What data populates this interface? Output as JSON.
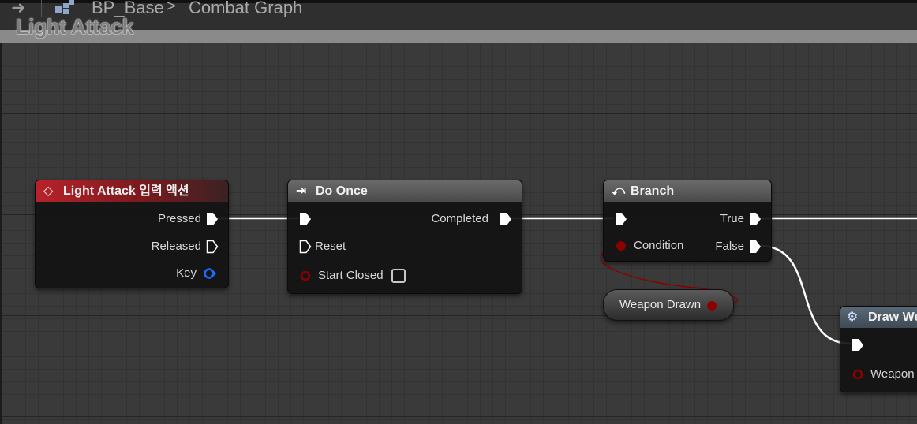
{
  "breadcrumb": {
    "blueprint": "BP_Base",
    "graph": "Combat Graph",
    "separator": ">"
  },
  "graph_title": "Light Attack",
  "colors": {
    "exec": "#ffffff",
    "bool": "#8e0000",
    "struct": "#1a6cff",
    "red_header": "#b8222a"
  },
  "nodes": {
    "input_action": {
      "title": "Light Attack 입력 액션",
      "icon": "diamond-icon",
      "pins": {
        "pressed": "Pressed",
        "released": "Released",
        "key": "Key"
      }
    },
    "do_once": {
      "title": "Do Once",
      "icon": "do-once-icon",
      "pins": {
        "completed": "Completed",
        "reset": "Reset",
        "start_closed": "Start Closed"
      },
      "start_closed_checked": false
    },
    "branch": {
      "title": "Branch",
      "icon": "branch-icon",
      "pins": {
        "condition": "Condition",
        "true": "True",
        "false": "False"
      }
    },
    "weapon_drawn": {
      "label": "Weapon Drawn"
    },
    "draw_weapon": {
      "title": "Draw We",
      "icon": "gear-icon",
      "pins": {
        "weapon": "Weapon"
      }
    }
  }
}
